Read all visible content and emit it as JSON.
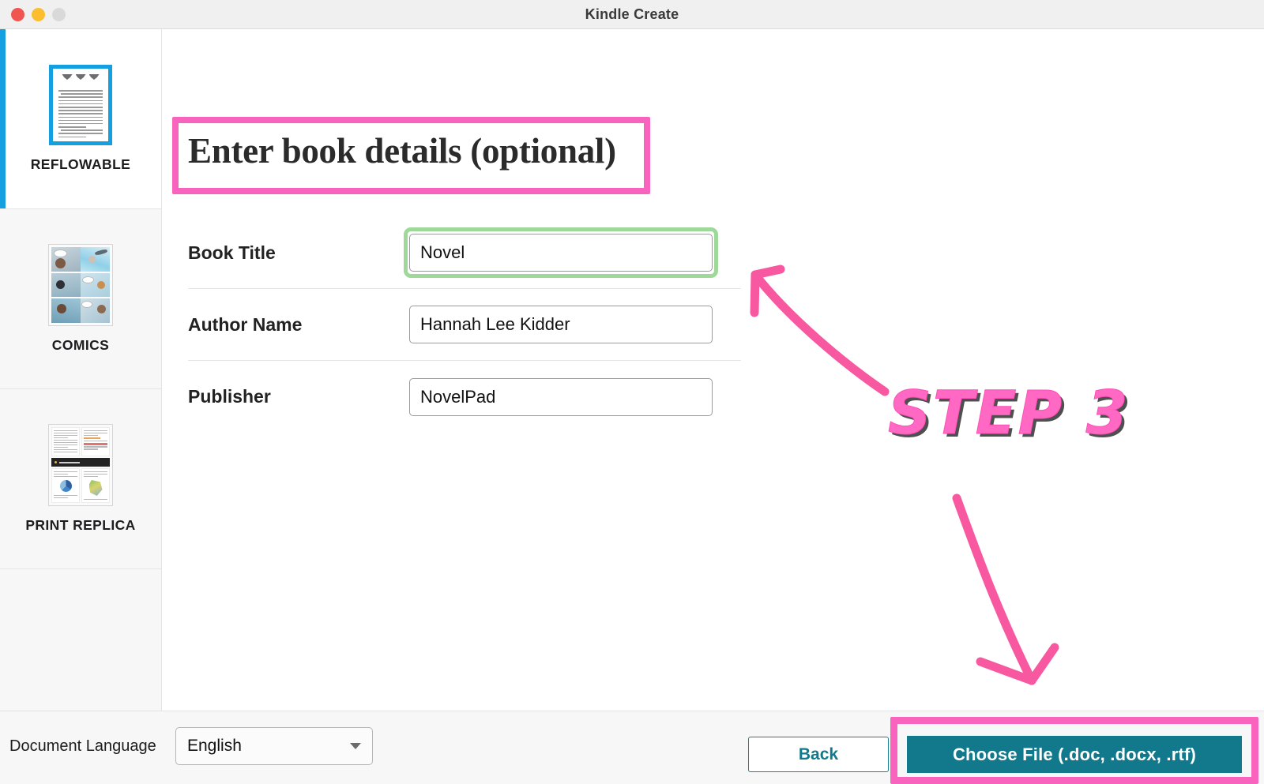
{
  "window": {
    "title": "Kindle Create",
    "traffic_lights": [
      "close",
      "minimize",
      "zoom"
    ]
  },
  "sidebar": {
    "items": [
      {
        "id": "reflowable",
        "label": "REFLOWABLE",
        "selected": true
      },
      {
        "id": "comics",
        "label": "COMICS",
        "selected": false
      },
      {
        "id": "print-replica",
        "label": "PRINT REPLICA",
        "selected": false
      }
    ]
  },
  "main": {
    "heading": "Enter book details (optional)",
    "fields": [
      {
        "id": "book-title",
        "label": "Book Title",
        "value": "Novel",
        "highlighted": true
      },
      {
        "id": "author-name",
        "label": "Author Name",
        "value": "Hannah Lee Kidder",
        "highlighted": false
      },
      {
        "id": "publisher",
        "label": "Publisher",
        "value": "NovelPad",
        "highlighted": false
      }
    ]
  },
  "bottom_bar": {
    "language_label": "Document Language",
    "language_value": "English",
    "back_label": "Back",
    "choose_file_label": "Choose File  (.doc, .docx, .rtf)"
  },
  "annotations": {
    "step_text": "STEP 3",
    "highlight_color": "#f763bd",
    "step_color": "#ff69c4",
    "field_highlight_color": "#9ed99a",
    "selected_tab_color": "#14a0e0",
    "accent_teal": "#11798b"
  }
}
